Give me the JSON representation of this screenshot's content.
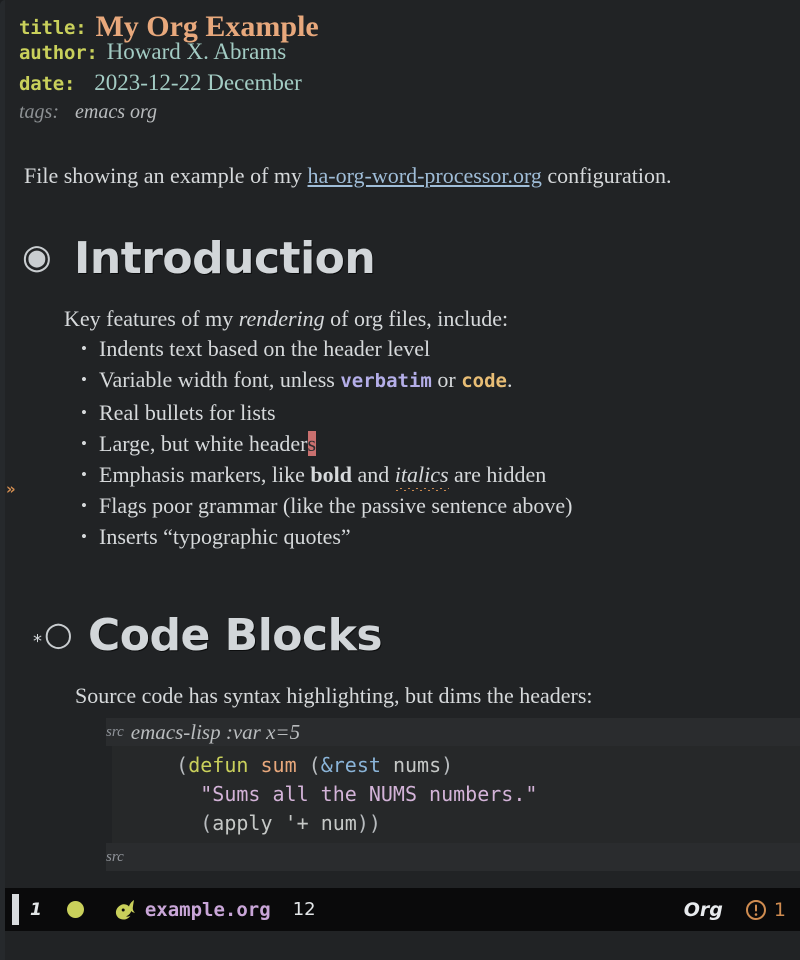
{
  "document": {
    "keywords": [
      {
        "label": "title:",
        "value": "My Org Example"
      },
      {
        "label": "author:",
        "value": "Howard X. Abrams"
      },
      {
        "label": "date:",
        "value": "2023-12-22 December"
      }
    ],
    "tags": {
      "label": "tags:",
      "value": "emacs org"
    },
    "intro_paragraph": {
      "before_link": "File showing an example of my ",
      "link_text": "ha-org-word-processor.org",
      "after_link": " configuration."
    },
    "sections": [
      {
        "bullet_glyph": "◉",
        "heading": "Introduction",
        "lead": {
          "before_italic": "Key features of my ",
          "italic": "rendering",
          "after_italic": " of org files, include:"
        },
        "items": [
          {
            "text": "Indents text based on the header level"
          },
          {
            "prefix": "Variable width font, unless ",
            "verbatim": "verbatim",
            "middle": " or ",
            "code": "code",
            "suffix": "."
          },
          {
            "text": "Real bullets for lists"
          },
          {
            "prefix": "Large, but white header",
            "cursor_char": "s"
          },
          {
            "prefix": "Emphasis markers, like ",
            "bold": "bold",
            "middle": " and ",
            "italic": "italics",
            "suffix": " are hidden"
          },
          {
            "text": "Flags poor grammar (like the passive sentence above)"
          },
          {
            "text": "Inserts “typographic quotes”"
          }
        ]
      },
      {
        "star": "*",
        "bullet_glyph": "○",
        "heading": "Code Blocks",
        "lead_plain": "Source code has syntax highlighting, but dims the headers:",
        "code_block": {
          "begin_keyword": "src",
          "begin_args": "emacs-lisp :var x=5",
          "end_keyword": "src",
          "lines": [
            {
              "tokens": [
                {
                  "t": "(",
                  "c": "paren"
                },
                {
                  "t": "defun",
                  "c": "kw"
                },
                {
                  "t": " ",
                  "c": "plain"
                },
                {
                  "t": "sum",
                  "c": "fn"
                },
                {
                  "t": " (",
                  "c": "paren"
                },
                {
                  "t": "&rest",
                  "c": "arg"
                },
                {
                  "t": " ",
                  "c": "plain"
                },
                {
                  "t": "nums",
                  "c": "var"
                },
                {
                  "t": ")",
                  "c": "paren"
                }
              ],
              "indent": 2
            },
            {
              "tokens": [
                {
                  "t": "\"Sums all the NUMS numbers.\"",
                  "c": "str"
                }
              ],
              "indent": 3
            },
            {
              "tokens": [
                {
                  "t": "(",
                  "c": "paren"
                },
                {
                  "t": "apply",
                  "c": "var"
                },
                {
                  "t": " ",
                  "c": "plain"
                },
                {
                  "t": "'+",
                  "c": "var"
                },
                {
                  "t": " ",
                  "c": "plain"
                },
                {
                  "t": "num",
                  "c": "var"
                },
                {
                  "t": "))",
                  "c": "paren"
                }
              ],
              "indent": 3
            }
          ]
        }
      }
    ]
  },
  "fringe": {
    "marker": "»"
  },
  "modeline": {
    "window_number": "1",
    "status_dot": "#c9d05b",
    "file_icon": "gnu-head-icon",
    "file_name": "example.org",
    "column": "12",
    "major_mode": "Org",
    "warning_icon": "circle-exclamation-icon",
    "warning_count": "1"
  },
  "colors": {
    "background": "#212325",
    "modeline_bg": "#0a0a0b",
    "title": "#e8a87c",
    "keyword": "#c9d05b",
    "value": "#a3ccc4",
    "link": "#9fbdd8",
    "cursor": "#c9706f",
    "heading": "#d2d6d9",
    "verbatim": "#b4aee8",
    "code": "#e8bd75",
    "string": "#d3b3d8",
    "accent_orange": "#d08c50"
  }
}
